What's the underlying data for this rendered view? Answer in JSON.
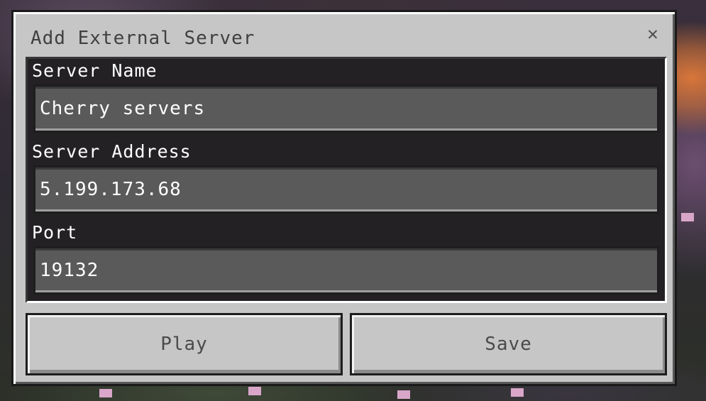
{
  "dialog": {
    "title": "Add External Server",
    "close_icon": "close-icon",
    "close_glyph": "✕"
  },
  "fields": {
    "server_name": {
      "label": "Server Name",
      "value": "Cherry servers"
    },
    "server_address": {
      "label": "Server Address",
      "value": "5.199.173.68"
    },
    "port": {
      "label": "Port",
      "value": "19132"
    }
  },
  "buttons": {
    "play_label": "Play",
    "save_label": "Save"
  },
  "colors": {
    "dialog_bg": "#c6c6c6",
    "panel_bg": "#0c0a0e",
    "field_bg": "#5a5a5a",
    "text_light": "#ffffff",
    "text_dark": "#404040",
    "sunset_accent": "#d8763a",
    "petal_pink": "#d9a6c9"
  }
}
